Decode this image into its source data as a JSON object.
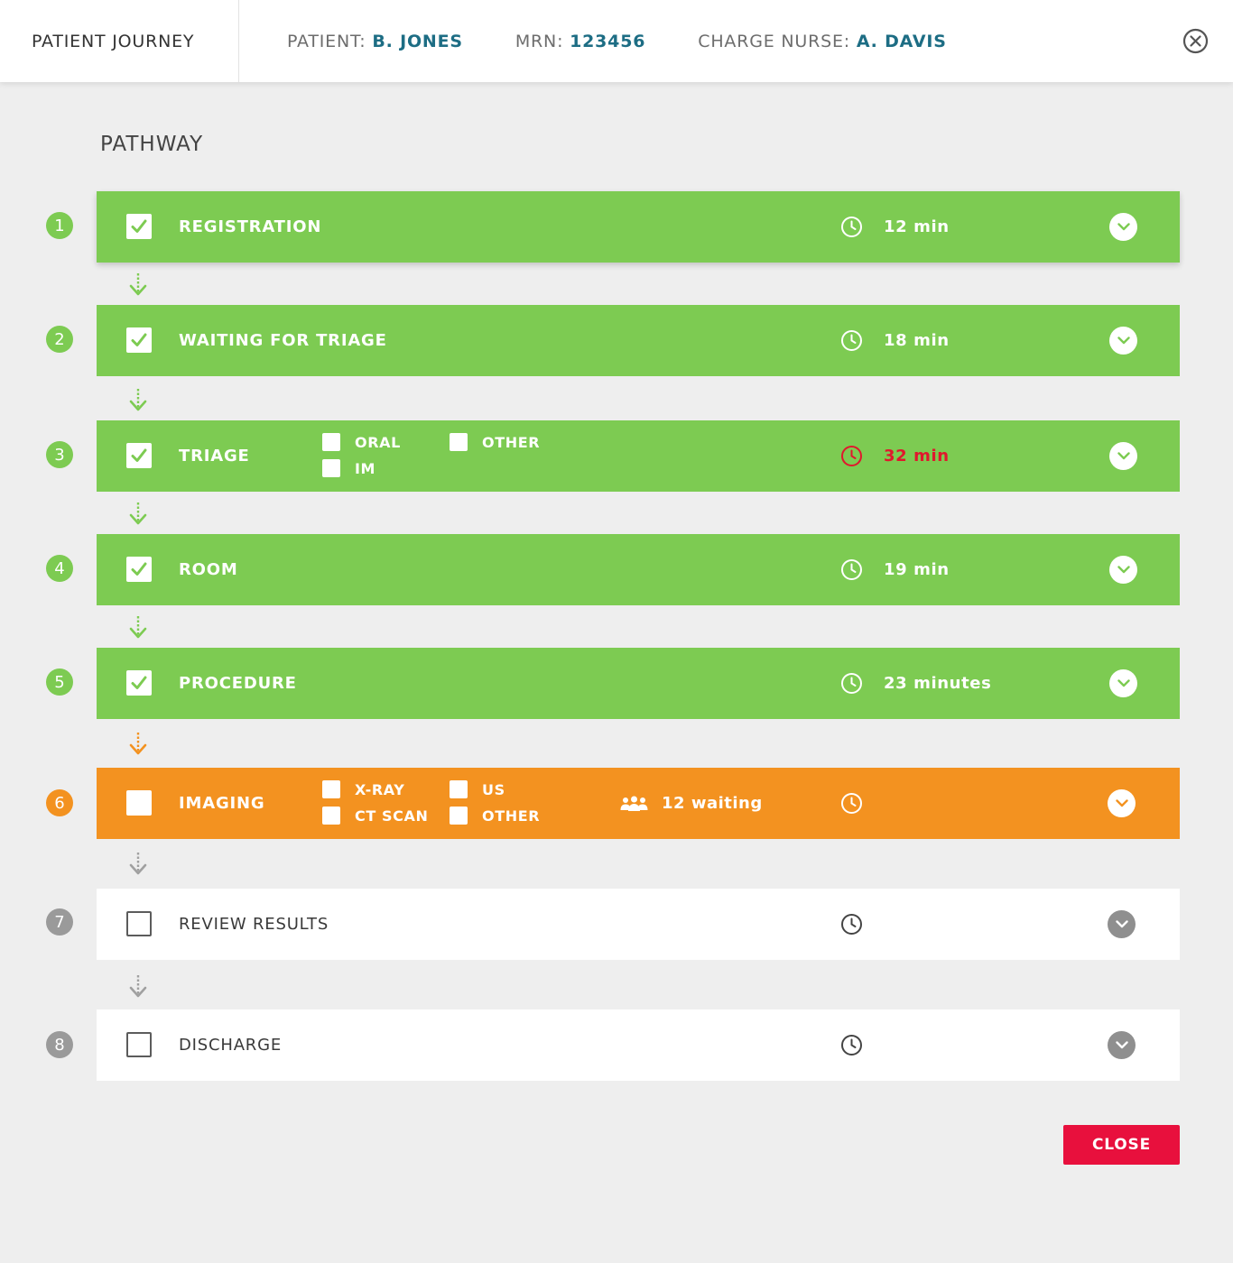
{
  "header": {
    "title": "PATIENT JOURNEY",
    "patient_label": "PATIENT:",
    "patient_value": "B. JONES",
    "mrn_label": "MRN:",
    "mrn_value": "123456",
    "nurse_label": "CHARGE NURSE:",
    "nurse_value": "A. DAVIS",
    "close_icon": "close-circle-icon"
  },
  "section_title": "PATHWAY",
  "steps": [
    {
      "number": "1",
      "label": "REGISTRATION",
      "status": "completed",
      "time": "12 min"
    },
    {
      "number": "2",
      "label": "WAITING FOR TRIAGE",
      "status": "completed",
      "time": "18 min"
    },
    {
      "number": "3",
      "label": "TRIAGE",
      "status": "completed",
      "time": "32 min",
      "time_late": true,
      "options": [
        "ORAL",
        "IM",
        "OTHER"
      ]
    },
    {
      "number": "4",
      "label": "ROOM",
      "status": "completed",
      "time": "19 min"
    },
    {
      "number": "5",
      "label": "PROCEDURE",
      "status": "completed",
      "time": "23 minutes"
    },
    {
      "number": "6",
      "label": "IMAGING",
      "status": "in-progress",
      "time": "",
      "options": [
        "X-RAY",
        "CT SCAN",
        "US",
        "OTHER"
      ],
      "waiting": "12 waiting"
    },
    {
      "number": "7",
      "label": "REVIEW RESULTS",
      "status": "pending",
      "time": ""
    },
    {
      "number": "8",
      "label": "DISCHARGE",
      "status": "pending",
      "time": ""
    }
  ],
  "colors": {
    "completed": "#7dcb52",
    "in_progress": "#f39220",
    "pending": "#ffffff",
    "accent_text": "#1d6d84",
    "late": "#e0182d",
    "close_button": "#e8103d"
  },
  "close_button_label": "CLOSE"
}
